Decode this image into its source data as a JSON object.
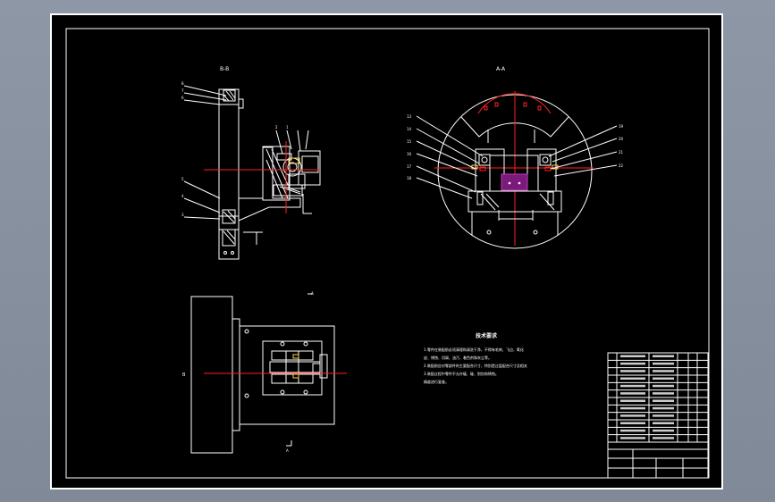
{
  "drawing": {
    "section_label_left": "B-B",
    "section_label_right": "A-A",
    "view_label_top": "A",
    "view_label_bottom": "A",
    "side_label": "B",
    "tech_title": "技术要求",
    "tech_lines": [
      "1.零件在装配前必须清理和清洗干净，不得有毛刺、飞边、氧化",
      "  皮、锈蚀、切屑、油污、着色剂和灰尘等。",
      "2.装配前应对零部件的主要配合尺寸，特别是过盈配合尺寸及相关",
      "3.装配过程中零件不允许磕、碰、划伤和锈蚀。",
      "  精度进行复查。"
    ],
    "left_callouts": [
      "8",
      "7",
      "6",
      "5",
      "4",
      "3",
      "2",
      "1"
    ],
    "right_callouts_left": [
      "13",
      "14",
      "15",
      "16",
      "17",
      "18"
    ],
    "right_callouts_right": [
      "19",
      "20",
      "21",
      "22"
    ]
  },
  "colors": {
    "line": "#ffffff",
    "center": "#ff2020",
    "dimension": "#ffd24a",
    "highlight": "#c040c0"
  }
}
